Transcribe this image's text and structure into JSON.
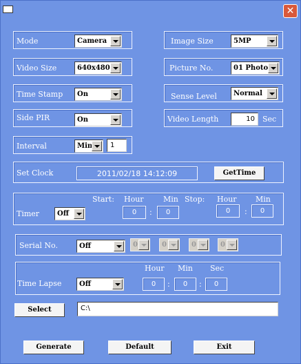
{
  "titlebar": {
    "close": "✕"
  },
  "mode": {
    "label": "Mode",
    "value": "Camera"
  },
  "image_size": {
    "label": "Image Size",
    "value": "5MP"
  },
  "video_size": {
    "label": "Video Size",
    "value": "640x480"
  },
  "picture_no": {
    "label": "Picture No.",
    "value": "01 Photo"
  },
  "time_stamp": {
    "label": "Time Stamp",
    "value": "On"
  },
  "sense_level": {
    "label": "Sense Level",
    "value": "Normal"
  },
  "side_pir": {
    "label": "Side PIR",
    "value": "On"
  },
  "video_length": {
    "label": "Video Length",
    "value": "10",
    "unit": "Sec"
  },
  "interval": {
    "label": "Interval",
    "unit": "Min",
    "value": "1"
  },
  "set_clock": {
    "label": "Set Clock",
    "value": "2011/02/18 14:12:09",
    "button": "GetTime"
  },
  "timer": {
    "label": "Timer",
    "value": "Off",
    "start": "Start:",
    "stop": "Stop:",
    "hour": "Hour",
    "min": "Min",
    "start_hour": "0",
    "start_min": "0",
    "stop_hour": "0",
    "stop_min": "0"
  },
  "serial_no": {
    "label": "Serial No.",
    "value": "Off",
    "digits": [
      "0",
      "0",
      "0",
      "0"
    ]
  },
  "time_lapse": {
    "label": "Time Lapse",
    "value": "Off",
    "hour": "Hour",
    "min": "Min",
    "sec": "Sec",
    "h": "0",
    "m": "0",
    "s": "0"
  },
  "path": {
    "button": "Select",
    "value": "C:\\"
  },
  "actions": {
    "generate": "Generate",
    "default": "Default",
    "exit": "Exit"
  }
}
